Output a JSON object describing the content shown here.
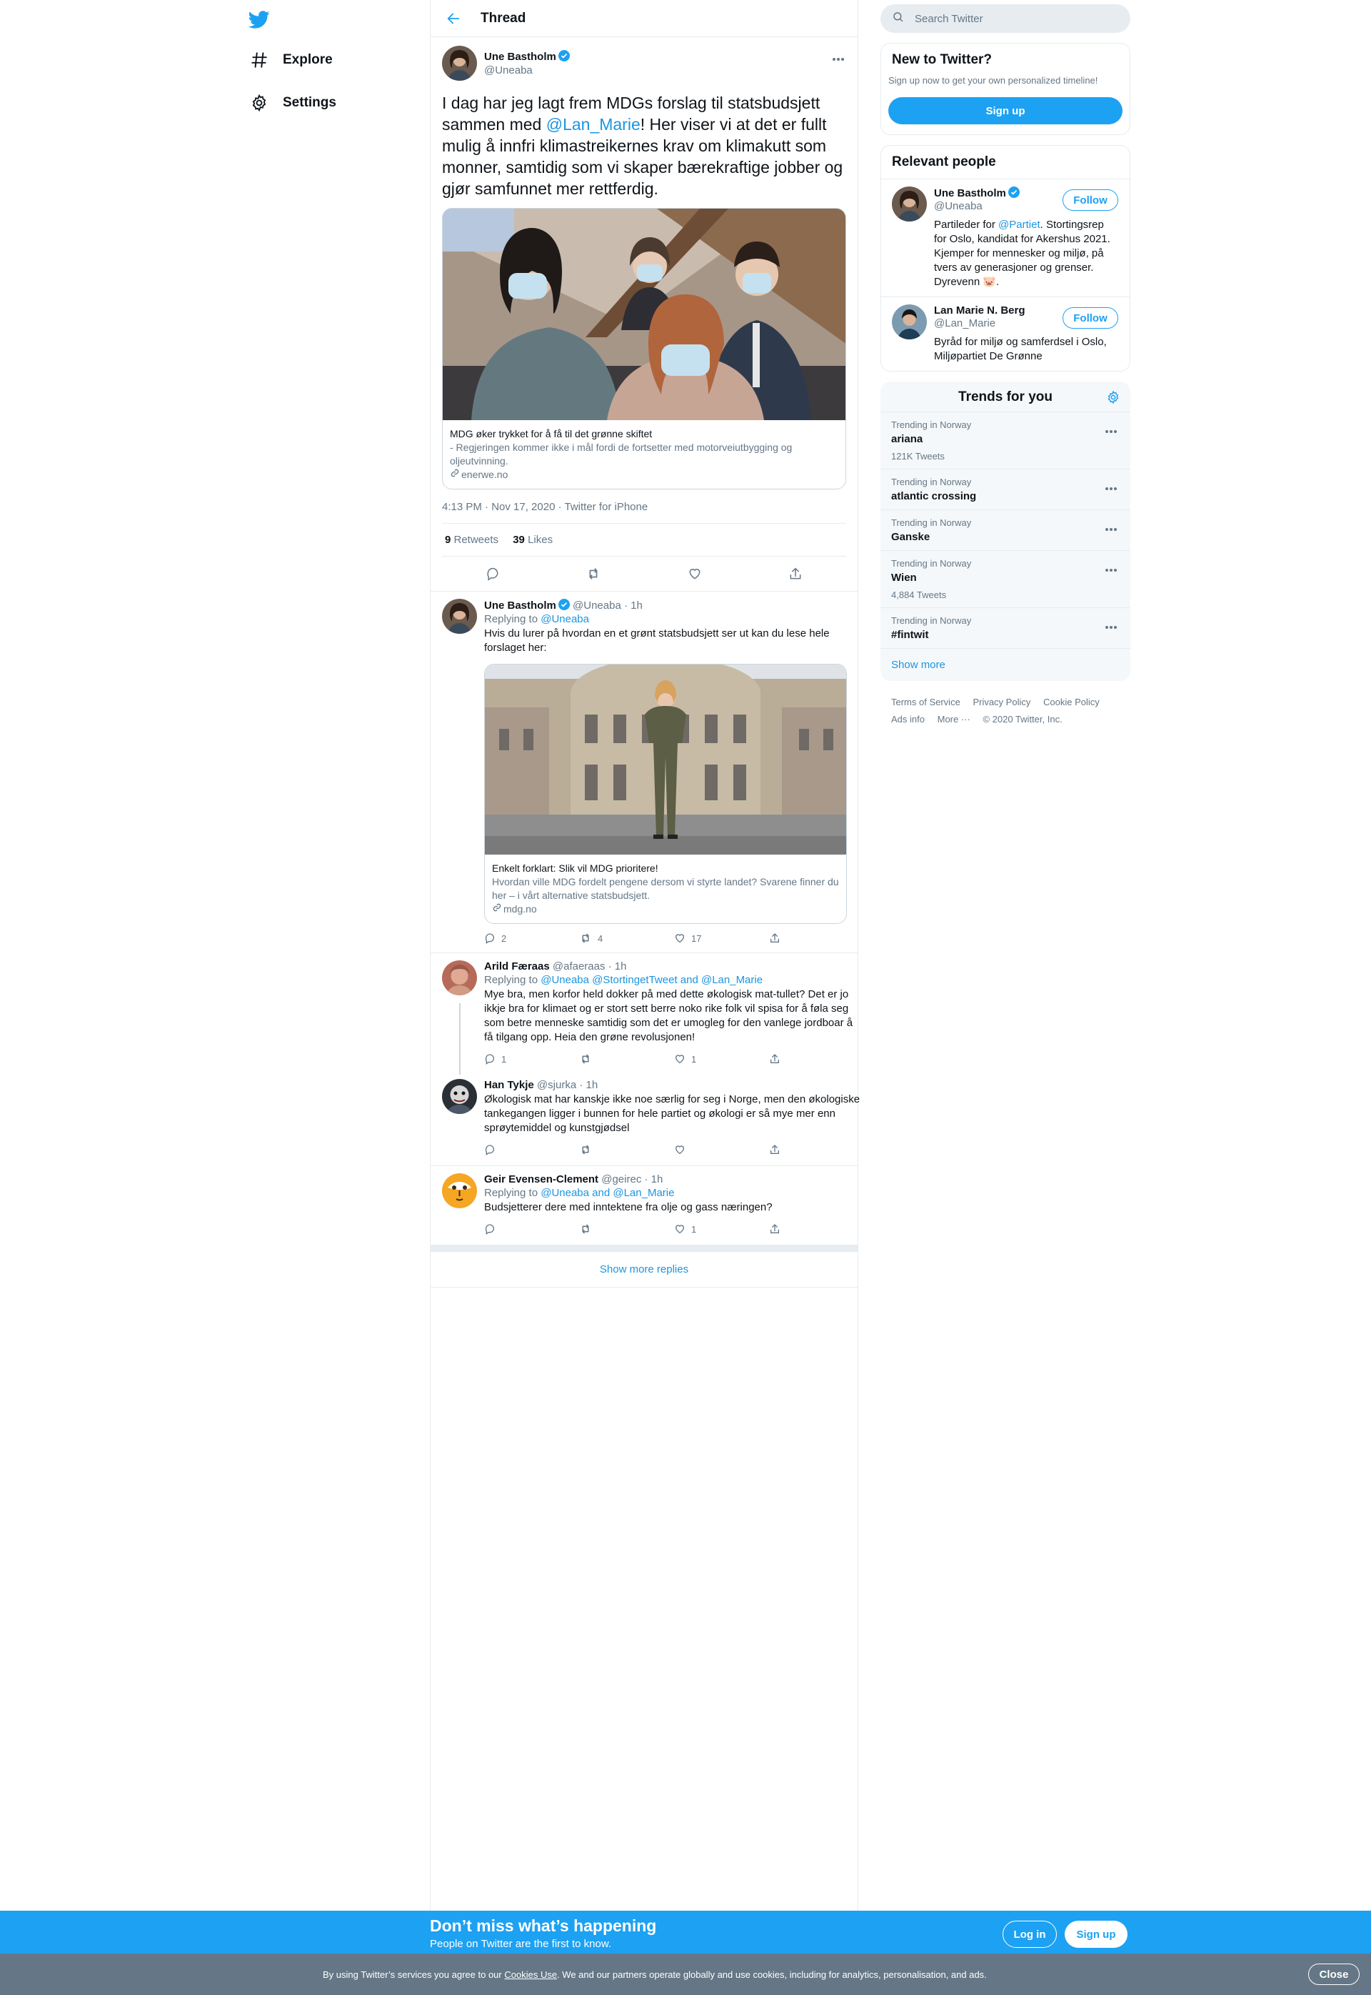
{
  "nav": {
    "items": [
      {
        "label": "Explore",
        "icon": "hashtag-icon"
      },
      {
        "label": "Settings",
        "icon": "gear-icon"
      }
    ]
  },
  "header": {
    "title": "Thread"
  },
  "focal": {
    "name": "Une Bastholm",
    "handle": "@Uneaba",
    "text_before": "I dag har jeg lagt frem MDGs forslag til statsbudsjett sammen med ",
    "mention": "@Lan_Marie",
    "text_after": "! Her viser vi at det er fullt mulig å innfri klimastreikernes krav om klimakutt som monner, samtidig som vi skaper bærekraftige jobber og gjør samfunnet mer rettferdig.",
    "card": {
      "title": "MDG øker trykket for å få til det grønne skiftet",
      "desc": "- Regjeringen kommer ikke i mål fordi de fortsetter med motorveiutbygging og oljeutvinning.",
      "link": "enerwe.no"
    },
    "time": "4:13 PM · Nov 17, 2020 · Twitter for iPhone",
    "retweets": "9",
    "retweets_label": " Retweets",
    "likes": "39",
    "likes_label": " Likes"
  },
  "replies": [
    {
      "name": "Une Bastholm",
      "handle": "@Uneaba · 1h",
      "replying": "Replying to ",
      "replying_to": "@Uneaba",
      "text": "Hvis du lurer på hvordan en et grønt statsbudsjett ser ut kan du lese hele forslaget her:",
      "card": {
        "title": "Enkelt forklart: Slik vil MDG prioritere!",
        "desc": "Hvordan ville MDG fordelt pengene dersom vi styrte landet? Svarene finner du her – i vårt alternative statsbudsjett.",
        "link": "mdg.no"
      },
      "replies": "2",
      "retweets": "4",
      "likes": "17"
    },
    {
      "name": "Arild Færaas",
      "handle": "@afaeraas · 1h",
      "replying": "Replying to ",
      "replying_to": "@Uneaba @StortingetTweet and @Lan_Marie",
      "text": "Mye bra, men korfor held dokker på med dette økologisk mat-tullet? Det er jo ikkje bra for klimaet og er stort sett berre noko rike folk vil spisa for å føla seg som betre menneske samtidig som det er umogleg for den vanlege jordboar å få tilgang opp. Heia den grøne revolusjonen!",
      "replies": "1",
      "retweets": "",
      "likes": "1"
    },
    {
      "name": "Han Tykje",
      "handle": "@sjurka · 1h",
      "text": "Økologisk mat har kanskje ikke noe særlig for seg i Norge, men den økologiske tankegangen ligger i bunnen for hele partiet og økologi er så mye mer enn sprøytemiddel og kunstgjødsel",
      "replies": "",
      "retweets": "",
      "likes": ""
    },
    {
      "name": "Geir Evensen-Clement",
      "handle": "@geirec · 1h",
      "replying": "Replying to ",
      "replying_to": "@Uneaba and @Lan_Marie",
      "text": "Budsjetterer dere med inntektene fra olje og gass næringen?",
      "replies": "",
      "retweets": "",
      "likes": "1"
    }
  ],
  "show_more_replies": "Show more replies",
  "search": {
    "placeholder": "Search Twitter"
  },
  "new_to_twitter": {
    "title": "New to Twitter?",
    "sub": "Sign up now to get your own personalized timeline!",
    "button": "Sign up"
  },
  "relevant": {
    "title": "Relevant people",
    "people": [
      {
        "name": "Une Bastholm",
        "handle": "@Uneaba",
        "bio_before": "Partileder for ",
        "bio_mention": "@Partiet",
        "bio_after": ". Stortingsrep for Oslo, kandidat for Akershus 2021. Kjemper for mennesker og miljø, på tvers av generasjoner og grenser. Dyrevenn 🐷.",
        "button": "Follow"
      },
      {
        "name": "Lan Marie N. Berg",
        "handle": "@Lan_Marie",
        "bio": "Byråd for miljø og samferdsel i Oslo, Miljøpartiet De Grønne",
        "button": "Follow"
      }
    ]
  },
  "trends": {
    "title": "Trends for you",
    "items": [
      {
        "context": "Trending in Norway",
        "name": "ariana",
        "count": "121K Tweets"
      },
      {
        "context": "Trending in Norway",
        "name": "atlantic crossing",
        "count": ""
      },
      {
        "context": "Trending in Norway",
        "name": "Ganske",
        "count": ""
      },
      {
        "context": "Trending in Norway",
        "name": "Wien",
        "count": "4,884 Tweets"
      },
      {
        "context": "Trending in Norway",
        "name": "#fintwit",
        "count": ""
      }
    ],
    "show_more": "Show more"
  },
  "footer": {
    "terms": "Terms of Service",
    "privacy": "Privacy Policy",
    "cookie": "Cookie Policy",
    "ads": "Ads info",
    "more": "More ···",
    "copyright": "© 2020 Twitter, Inc."
  },
  "banner": {
    "title": "Don’t miss what’s happening",
    "sub": "People on Twitter are the first to know.",
    "login": "Log in",
    "signup": "Sign up"
  },
  "cookie_bar": {
    "before": "By using Twitter’s services you agree to our ",
    "link": "Cookies Use",
    "after": ". We and our partners operate globally and use cookies, including for analytics, personalisation, and ads.",
    "close": "Close"
  },
  "colors": {
    "accent": "#1da1f2",
    "link": "#1b95e0",
    "secondary": "#657786",
    "border": "#e6ecf0"
  }
}
